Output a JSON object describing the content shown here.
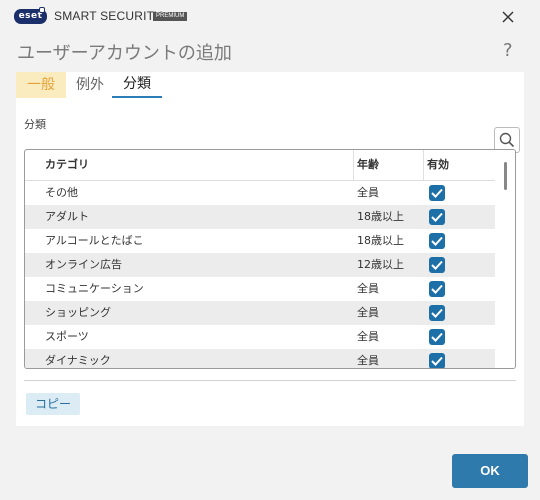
{
  "app": {
    "logo_text": "eset",
    "product_name": "SMART SECURITY",
    "edition": "PREMIUM"
  },
  "dialog": {
    "title": "ユーザーアカウントの追加",
    "help": "?"
  },
  "tabs": [
    {
      "label": "一般",
      "state": "highlighted"
    },
    {
      "label": "例外",
      "state": "normal"
    },
    {
      "label": "分類",
      "state": "selected"
    }
  ],
  "section": {
    "label": "分類"
  },
  "table": {
    "columns": {
      "category": "カテゴリ",
      "age": "年齢",
      "enabled": "有効"
    },
    "rows": [
      {
        "category": "その他",
        "age": "全員",
        "enabled": true
      },
      {
        "category": "アダルト",
        "age": "18歳以上",
        "enabled": true
      },
      {
        "category": "アルコールとたばこ",
        "age": "18歳以上",
        "enabled": true
      },
      {
        "category": "オンライン広告",
        "age": "12歳以上",
        "enabled": true
      },
      {
        "category": "コミュニケーション",
        "age": "全員",
        "enabled": true
      },
      {
        "category": "ショッピング",
        "age": "全員",
        "enabled": true
      },
      {
        "category": "スポーツ",
        "age": "全員",
        "enabled": true
      },
      {
        "category": "ダイナミック",
        "age": "全員",
        "enabled": true
      }
    ]
  },
  "buttons": {
    "copy": "コピー",
    "ok": "OK"
  },
  "colors": {
    "accent": "#2f7aad",
    "checkbox": "#1d6fa8",
    "tab_highlight_bg": "#fbecc0",
    "tab_highlight_text": "#e4a33a"
  },
  "icons": {
    "close": "close-icon",
    "search": "search-icon",
    "help": "help-icon",
    "check": "checkmark-icon"
  }
}
